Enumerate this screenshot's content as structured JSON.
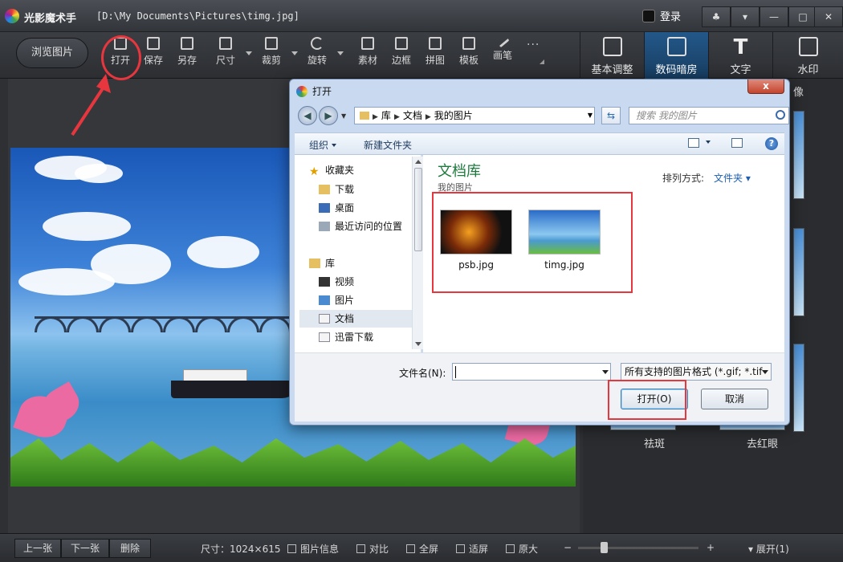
{
  "titlebar": {
    "app_name": "光影魔术手",
    "path": "[D:\\My Documents\\Pictures\\timg.jpg]",
    "login": "登录"
  },
  "toolbar": {
    "browse": "浏览图片",
    "tools": [
      {
        "label": "打开",
        "icon": "open-image-icon"
      },
      {
        "label": "保存",
        "icon": "save-icon"
      },
      {
        "label": "另存",
        "icon": "save-as-icon"
      },
      {
        "label": "尺寸",
        "icon": "resize-icon"
      },
      {
        "label": "裁剪",
        "icon": "crop-icon"
      },
      {
        "label": "旋转",
        "icon": "rotate-icon"
      },
      {
        "label": "素材",
        "icon": "material-icon"
      },
      {
        "label": "边框",
        "icon": "border-icon"
      },
      {
        "label": "拼图",
        "icon": "collage-icon"
      },
      {
        "label": "模板",
        "icon": "template-icon"
      },
      {
        "label": "画笔",
        "icon": "brush-icon"
      }
    ],
    "more": "···",
    "right_tabs": [
      {
        "label": "基本调整",
        "icon": "edit-icon"
      },
      {
        "label": "数码暗房",
        "icon": "camera-icon"
      },
      {
        "label": "文字",
        "icon": "text-icon",
        "glyph": "T"
      },
      {
        "label": "水印",
        "icon": "watermark-icon"
      }
    ]
  },
  "right_panel": {
    "labels": [
      "像",
      "祛斑",
      "去红眼"
    ]
  },
  "bottombar": {
    "prev": "上一张",
    "next": "下一张",
    "delete": "删除",
    "size_label": "尺寸：1024×615",
    "info": "图片信息",
    "compare": "对比",
    "fullscreen": "全屏",
    "fit": "适屏",
    "original": "原大",
    "minus": "−",
    "plus": "+",
    "expand": "展开(1)"
  },
  "dialog": {
    "title": "打开",
    "close": "x",
    "address": {
      "segments": [
        "库",
        "文档",
        "我的图片"
      ]
    },
    "search_placeholder": "搜索 我的图片",
    "organize": "组织",
    "new_folder": "新建文件夹",
    "help": "?",
    "nav": {
      "favorites": "收藏夹",
      "items_fav": [
        "下载",
        "桌面",
        "最近访问的位置"
      ],
      "libraries": "库",
      "items_lib": [
        "视频",
        "图片",
        "文档",
        "迅雷下载"
      ]
    },
    "library_title": "文档库",
    "library_sub": "我的图片",
    "sort_label": "排列方式:",
    "sort_value": "文件夹",
    "files": [
      {
        "name": "psb.jpg"
      },
      {
        "name": "timg.jpg"
      }
    ],
    "filename_label": "文件名(N):",
    "filename_value": "",
    "filter": "所有支持的图片格式 (*.gif; *.tif",
    "open_button": "打开(O)",
    "cancel_button": "取消"
  },
  "colors": {
    "accent": "#1a5a8e",
    "annotation": "#e8363e",
    "library_title": "#1e7a3c"
  }
}
